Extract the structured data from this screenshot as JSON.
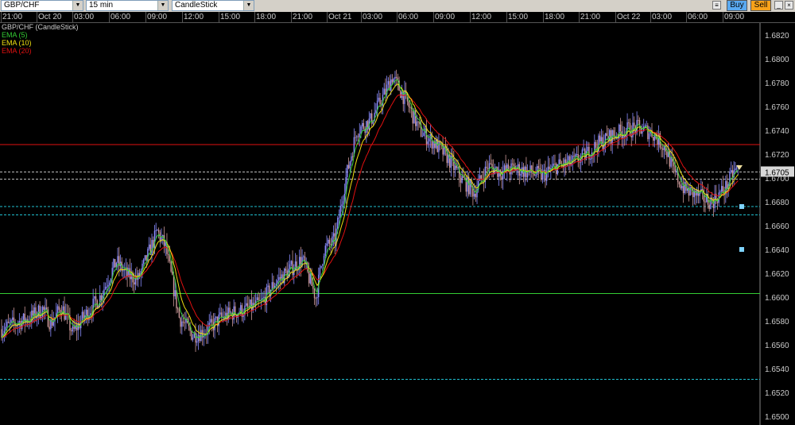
{
  "toolbar": {
    "symbol": "GBP/CHF",
    "timeframe": "15 min",
    "chart_type": "CandleStick",
    "buy_label": "Buy",
    "sell_label": "Sell",
    "buy_color": "#5aa9f0",
    "sell_color": "#f7a21b"
  },
  "legend": {
    "title": "GBP/CHF (CandleStick)",
    "ema5": "EMA (5)",
    "ema10": "EMA (10)",
    "ema20": "EMA (20)",
    "ema5_color": "#33cc33",
    "ema10_color": "#f0e010",
    "ema20_color": "#e01010"
  },
  "time_labels": [
    "21:00",
    "Oct 20",
    "03:00",
    "06:00",
    "09:00",
    "12:00",
    "15:00",
    "18:00",
    "21:00",
    "Oct 21",
    "03:00",
    "06:00",
    "09:00",
    "12:00",
    "15:00",
    "18:00",
    "21:00",
    "Oct 22",
    "03:00",
    "06:00",
    "09:00"
  ],
  "price_labels": [
    "1.6820",
    "1.6800",
    "1.6780",
    "1.6760",
    "1.6740",
    "1.6720",
    "1.6705",
    "1.6700",
    "1.6680",
    "1.6660",
    "1.6640",
    "1.6620",
    "1.6600",
    "1.6580",
    "1.6560",
    "1.6540",
    "1.6520",
    "1.6500"
  ],
  "chart_data": {
    "type": "candlestick",
    "symbol": "GBP/CHF",
    "timeframe": "15 min",
    "ylim": [
      1.6495,
      1.683
    ],
    "current_price": 1.6705,
    "indicators": [
      "EMA (5)",
      "EMA (10)",
      "EMA (20)"
    ],
    "horizontal_lines": [
      {
        "price": 1.6728,
        "color": "#e01010",
        "style": "solid"
      },
      {
        "price": 1.6603,
        "color": "#33cc33",
        "style": "solid"
      },
      {
        "price": 1.6705,
        "color": "#bbbbbb",
        "style": "dashed"
      },
      {
        "price": 1.6699,
        "color": "#bbbbbb",
        "style": "dashed"
      },
      {
        "price": 1.6676,
        "color": "#20c0d0",
        "style": "dashed"
      },
      {
        "price": 1.6669,
        "color": "#20c0d0",
        "style": "dashed"
      },
      {
        "price": 1.6531,
        "color": "#20c0d0",
        "style": "dashed"
      }
    ],
    "path_anchors": [
      [
        0,
        1.6573
      ],
      [
        10,
        1.6578
      ],
      [
        20,
        1.6582
      ],
      [
        30,
        1.659
      ],
      [
        36,
        1.6578
      ],
      [
        44,
        1.6592
      ],
      [
        52,
        1.657
      ],
      [
        60,
        1.6583
      ],
      [
        72,
        1.66
      ],
      [
        84,
        1.663
      ],
      [
        92,
        1.6618
      ],
      [
        100,
        1.6615
      ],
      [
        114,
        1.6655
      ],
      [
        120,
        1.6642
      ],
      [
        130,
        1.6583
      ],
      [
        140,
        1.6568
      ],
      [
        150,
        1.6572
      ],
      [
        160,
        1.6582
      ],
      [
        170,
        1.6587
      ],
      [
        180,
        1.659
      ],
      [
        190,
        1.6595
      ],
      [
        200,
        1.6612
      ],
      [
        210,
        1.6622
      ],
      [
        220,
        1.6632
      ],
      [
        230,
        1.66
      ],
      [
        236,
        1.664
      ],
      [
        244,
        1.6648
      ],
      [
        252,
        1.67
      ],
      [
        260,
        1.674
      ],
      [
        270,
        1.6748
      ],
      [
        280,
        1.677
      ],
      [
        286,
        1.6785
      ],
      [
        296,
        1.6765
      ],
      [
        306,
        1.674
      ],
      [
        316,
        1.673
      ],
      [
        326,
        1.6718
      ],
      [
        336,
        1.67
      ],
      [
        346,
        1.6688
      ],
      [
        356,
        1.671
      ],
      [
        366,
        1.6705
      ],
      [
        376,
        1.6708
      ],
      [
        386,
        1.6705
      ],
      [
        396,
        1.6702
      ],
      [
        406,
        1.671
      ],
      [
        416,
        1.6712
      ],
      [
        426,
        1.6718
      ],
      [
        436,
        1.6728
      ],
      [
        446,
        1.6735
      ],
      [
        456,
        1.674
      ],
      [
        466,
        1.6742
      ],
      [
        476,
        1.6738
      ],
      [
        486,
        1.6725
      ],
      [
        492,
        1.6705
      ],
      [
        500,
        1.669
      ],
      [
        510,
        1.6685
      ],
      [
        520,
        1.668
      ],
      [
        530,
        1.6692
      ],
      [
        536,
        1.6705
      ],
      [
        540,
        1.6708
      ]
    ]
  }
}
